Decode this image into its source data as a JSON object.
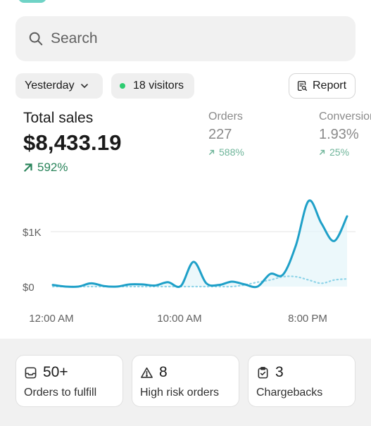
{
  "search": {
    "placeholder": "Search"
  },
  "filters": {
    "date_label": "Yesterday",
    "visitors_label": "18 visitors",
    "report_label": "Report"
  },
  "metrics": {
    "total_sales": {
      "label": "Total sales",
      "value": "$8,433.19",
      "delta": "592%"
    },
    "orders": {
      "label": "Orders",
      "value": "227",
      "delta": "588%"
    },
    "conversion": {
      "label": "Conversion",
      "value": "1.93%",
      "delta": "25%"
    }
  },
  "chart_data": {
    "type": "line",
    "x_tick_labels": [
      "12:00 AM",
      "10:00 AM",
      "8:00 PM"
    ],
    "y_tick_labels": [
      "$1K",
      "$0"
    ],
    "yticks": [
      0,
      1000
    ],
    "ylim": [
      0,
      1600
    ],
    "x": [
      0,
      1,
      2,
      3,
      4,
      5,
      6,
      7,
      8,
      9,
      10,
      11,
      12,
      13,
      14,
      15,
      16,
      17,
      18,
      19,
      20,
      21,
      22,
      23
    ],
    "series": [
      {
        "values": [
          30,
          0,
          0,
          60,
          10,
          0,
          40,
          40,
          20,
          80,
          10,
          450,
          60,
          30,
          90,
          40,
          0,
          230,
          220,
          750,
          1560,
          1150,
          830,
          1280
        ]
      },
      {
        "values": [
          0,
          0,
          0,
          0,
          0,
          0,
          0,
          0,
          0,
          0,
          0,
          0,
          0,
          0,
          0,
          30,
          80,
          120,
          180,
          180,
          120,
          60,
          120,
          140
        ]
      }
    ],
    "colors": {
      "current": "#1fa0c8",
      "previous": "#8dd3e8",
      "grid": "#e3e3e3"
    },
    "grid": true,
    "legend": false
  },
  "cards": [
    {
      "icon": "inbox-icon",
      "value": "50+",
      "label": "Orders to fulfill"
    },
    {
      "icon": "alert-triangle-icon",
      "value": "8",
      "label": "High risk orders"
    },
    {
      "icon": "clipboard-check-icon",
      "value": "3",
      "label": "Chargebacks"
    }
  ]
}
